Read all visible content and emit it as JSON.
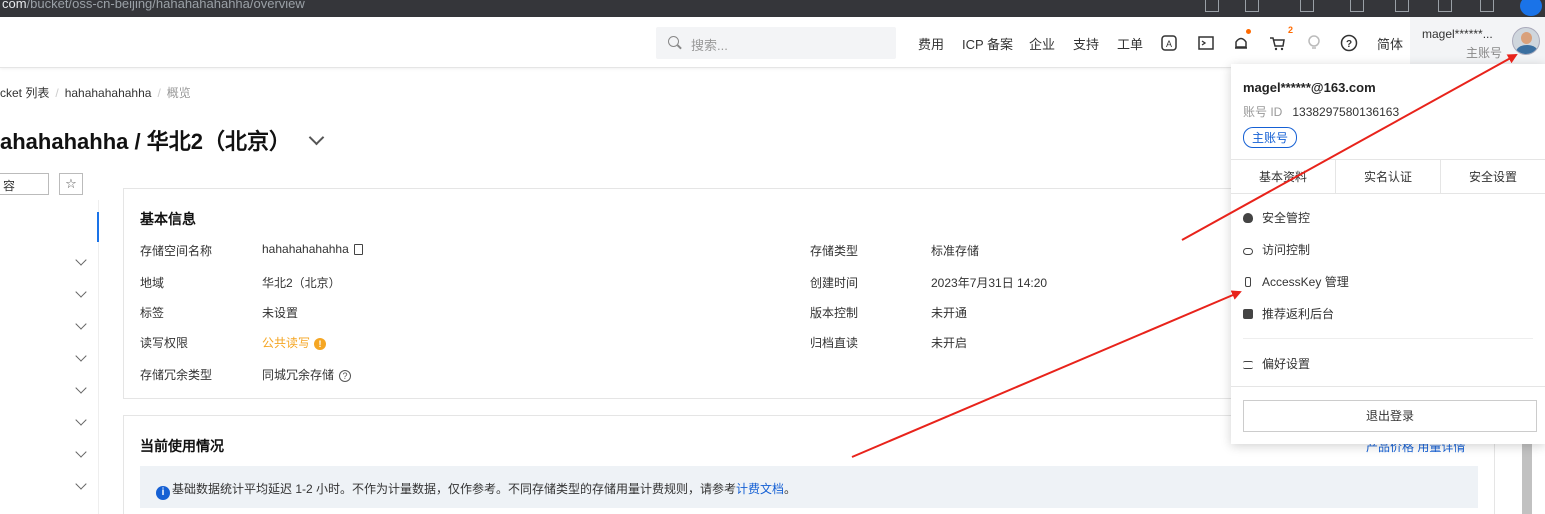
{
  "browser": {
    "url_prefix": "com",
    "url_rest": "/bucket/oss-cn-beijing/hahahahahahha/overview"
  },
  "topnav": {
    "search_placeholder": "搜索...",
    "links": [
      "费用",
      "ICP 备案",
      "企业",
      "支持",
      "工单"
    ],
    "cart_badge": "2",
    "lang": "简体",
    "user_name": "magel******...",
    "user_role": "主账号"
  },
  "breadcrumb": {
    "root": "cket 列表",
    "bucket": "hahahahahahha",
    "current": "概览"
  },
  "title": "ahahahahha / 华北2（北京）",
  "sidebar": {
    "search_text": "容",
    "star": "☆"
  },
  "basic_info": {
    "title": "基本信息",
    "left": [
      {
        "label": "存储空间名称",
        "value": "hahahahahahha"
      },
      {
        "label": "地域",
        "value": "华北2（北京）"
      },
      {
        "label": "标签",
        "value": "未设置"
      },
      {
        "label": "读写权限",
        "value": "公共读写"
      },
      {
        "label": "存储冗余类型",
        "value": "同城冗余存储"
      }
    ],
    "right": [
      {
        "label": "存储类型",
        "value": "标准存储"
      },
      {
        "label": "创建时间",
        "value": "2023年7月31日 14:20"
      },
      {
        "label": "版本控制",
        "value": "未开通"
      },
      {
        "label": "归档直读",
        "value": "未开启"
      }
    ]
  },
  "usage": {
    "title": "当前使用情况",
    "notice_text": "基础数据统计平均延迟 1-2 小时。不作为计量数据，仅作参考。不同存储类型的存储用量计费规则，请参考",
    "notice_link": "计费文档",
    "notice_end": "。",
    "links": "产品价格   用量详情"
  },
  "dropdown": {
    "email": "magel******@163.com",
    "id_label": "账号 ID",
    "id_value": "1338297580136163",
    "tag": "主账号",
    "tabs": [
      "基本资料",
      "实名认证",
      "安全设置"
    ],
    "items": [
      "安全管控",
      "访问控制",
      "AccessKey 管理",
      "推荐返利后台"
    ],
    "pref": "偏好设置",
    "logout": "退出登录"
  },
  "colors": {
    "accent": "#1560d4",
    "warning": "#f5a623",
    "arrow": "#e8231b",
    "brand_orange": "#ff6a00"
  }
}
